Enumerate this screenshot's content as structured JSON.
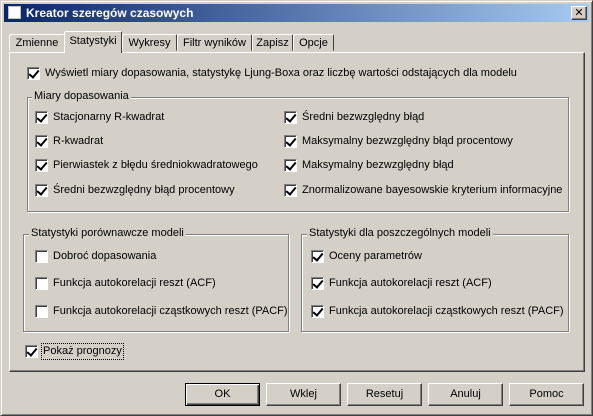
{
  "window": {
    "title": "Kreator szeregów czasowych",
    "close_glyph": "✕"
  },
  "tabs": [
    "Zmienne",
    "Statystyki",
    "Wykresy",
    "Filtr wyników",
    "Zapisz",
    "Opcje"
  ],
  "active_tab": "Statystyki",
  "main_option": {
    "label": "Wyświetl miary dopasowania, statystykę Ljung-Boxa oraz liczbę wartości odstających dla modelu",
    "checked": true
  },
  "fit_measures": {
    "title": "Miary dopasowania",
    "items": [
      {
        "label": "Stacjonarny R-kwadrat",
        "checked": true
      },
      {
        "label": "R-kwadrat",
        "checked": true
      },
      {
        "label": "Pierwiastek z błędu średniokwadratowego",
        "checked": true
      },
      {
        "label": "Średni bezwzględny błąd procentowy",
        "checked": true
      },
      {
        "label": "Średni bezwzględny błąd",
        "checked": true
      },
      {
        "label": "Maksymalny bezwzględny błąd procentowy",
        "checked": true
      },
      {
        "label": "Maksymalny bezwzględny błąd",
        "checked": true
      },
      {
        "label": "Znormalizowane bayesowskie kryterium informacyjne",
        "checked": true
      }
    ]
  },
  "comparative": {
    "title": "Statystyki porównawcze modeli",
    "items": [
      {
        "label": "Dobroć dopasowania",
        "checked": false
      },
      {
        "label": "Funkcja autokorelacji reszt (ACF)",
        "checked": false
      },
      {
        "label": "Funkcja autokorelacji cząstkowych reszt (PACF)",
        "checked": false
      }
    ]
  },
  "individual": {
    "title": "Statystyki dla poszczególnych modeli",
    "items": [
      {
        "label": "Oceny parametrów",
        "checked": true
      },
      {
        "label": "Funkcja autokorelacji reszt (ACF)",
        "checked": true
      },
      {
        "label": "Funkcja autokorelacji cząstkowych reszt (PACF)",
        "checked": true
      }
    ]
  },
  "forecast_option": {
    "label": "Pokaż prognozy",
    "checked": true
  },
  "buttons": {
    "ok": "OK",
    "paste": "Wklej",
    "reset": "Resetuj",
    "cancel": "Anuluj",
    "help": "Pomoc"
  },
  "colors": {
    "title_start": "#0a246a",
    "title_end": "#a6caf0",
    "face": "#d4d0c8"
  }
}
